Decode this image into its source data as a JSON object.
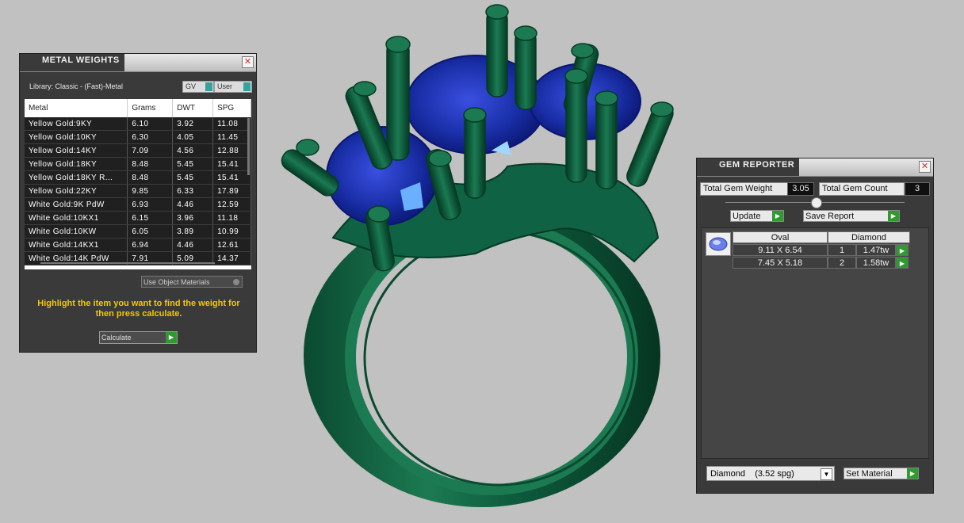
{
  "metal_weights": {
    "title": "METAL WEIGHTS",
    "library": "Library: Classic - (Fast)-Metal",
    "gv_label": "GV",
    "user_label": "User",
    "columns": [
      "Metal",
      "Grams",
      "DWT",
      "SPG"
    ],
    "rows": [
      [
        "Yellow Gold:9KY",
        "6.10",
        "3.92",
        "11.08"
      ],
      [
        "Yellow Gold:10KY",
        "6.30",
        "4.05",
        "11.45"
      ],
      [
        "Yellow Gold:14KY",
        "7.09",
        "4.56",
        "12.88"
      ],
      [
        "Yellow Gold:18KY",
        "8.48",
        "5.45",
        "15.41"
      ],
      [
        "Yellow Gold:18KY R...",
        "8.48",
        "5.45",
        "15.41"
      ],
      [
        "Yellow Gold:22KY",
        "9.85",
        "6.33",
        "17.89"
      ],
      [
        "White Gold:9K PdW",
        "6.93",
        "4.46",
        "12.59"
      ],
      [
        "White Gold:10KX1",
        "6.15",
        "3.96",
        "11.18"
      ],
      [
        "White Gold:10KW",
        "6.05",
        "3.89",
        "10.99"
      ],
      [
        "White Gold:14KX1",
        "6.94",
        "4.46",
        "12.61"
      ],
      [
        "White Gold:14K PdW",
        "7.91",
        "5.09",
        "14.37"
      ]
    ],
    "use_object_materials": "Use Object Materials",
    "hint": "Highlight the item you want to find the weight for then press calculate.",
    "calculate_label": "Calculate"
  },
  "gem_reporter": {
    "title": "GEM REPORTER",
    "total_weight_label": "Total Gem Weight",
    "total_weight_value": "3.05",
    "total_count_label": "Total Gem Count",
    "total_count_value": "3",
    "update_label": "Update",
    "save_report_label": "Save Report",
    "headers": [
      "Oval",
      "Diamond"
    ],
    "gems": [
      {
        "size": "9.11 X 6.54",
        "count": "1",
        "weight": "1.47tw"
      },
      {
        "size": "7.45 X 5.18",
        "count": "2",
        "weight": "1.58tw"
      }
    ],
    "material_selected": "Diamond    (3.52 spg)",
    "set_material_label": "Set Material"
  },
  "colors": {
    "ring_green": "#0d5a3c",
    "gem_blue": "#1a2fa8",
    "background": "#c1c1c1",
    "accent_yellow": "#f5c800",
    "go_green": "#2f9a2f"
  },
  "icons": [
    "close-icon",
    "go-arrow-icon",
    "gem-thumbnail-icon",
    "dropdown-arrow-icon",
    "app-icon"
  ]
}
